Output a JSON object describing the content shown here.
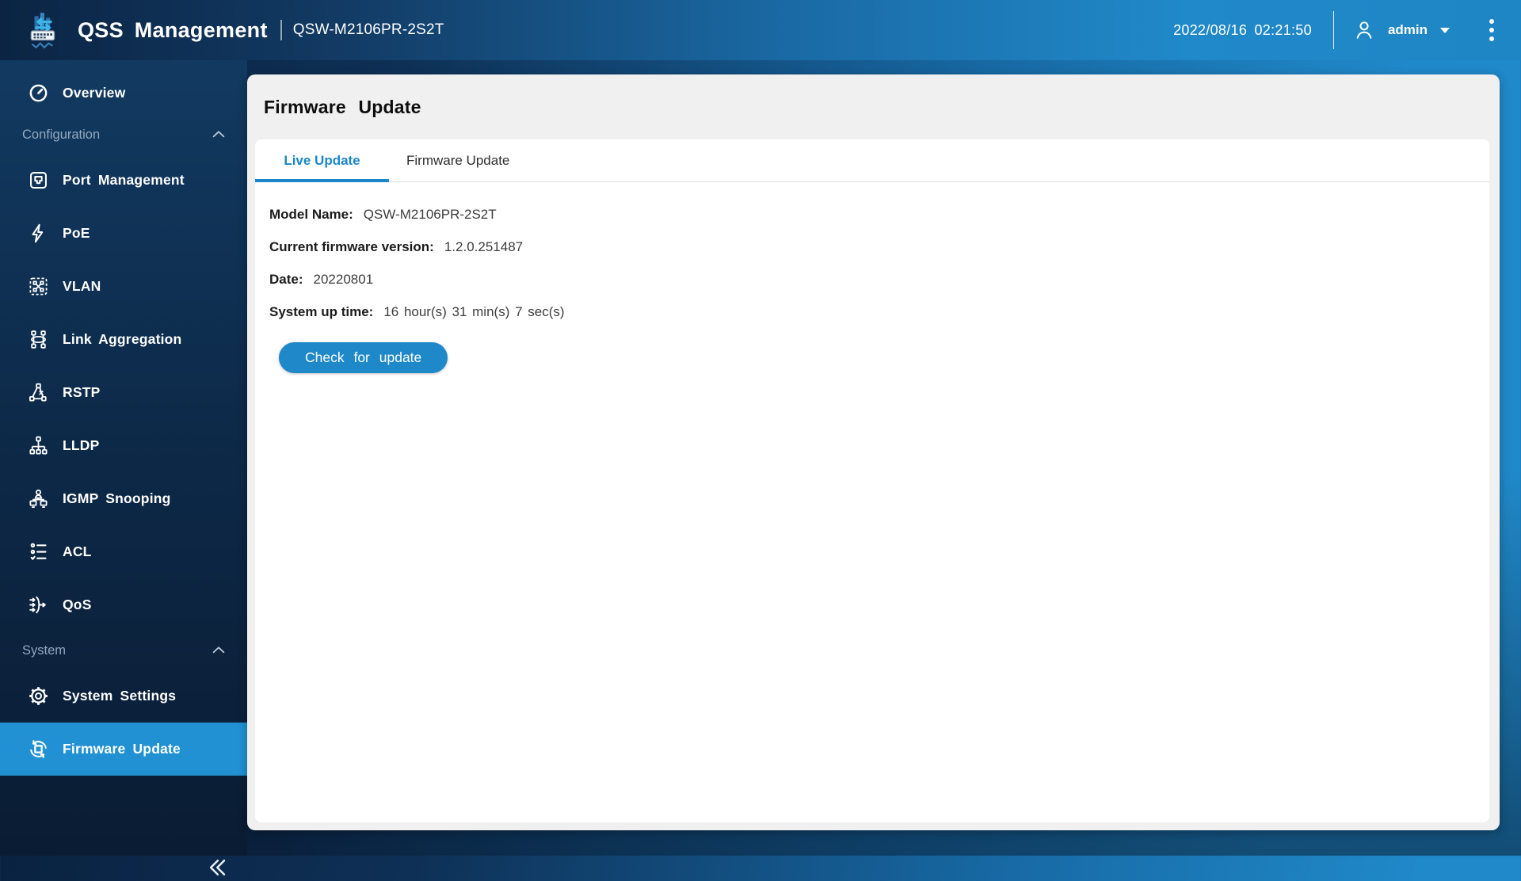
{
  "topbar": {
    "app_title": "QSS Management",
    "device_model": "QSW-M2106PR-2S2T",
    "datetime": "2022/08/16 02:21:50",
    "user": "admin"
  },
  "sidebar": {
    "items": [
      {
        "type": "item",
        "label": "Overview",
        "icon": "overview-icon"
      },
      {
        "type": "section",
        "label": "Configuration"
      },
      {
        "type": "item",
        "label": "Port Management",
        "icon": "port-management-icon"
      },
      {
        "type": "item",
        "label": "PoE",
        "icon": "poe-icon"
      },
      {
        "type": "item",
        "label": "VLAN",
        "icon": "vlan-icon"
      },
      {
        "type": "item",
        "label": "Link Aggregation",
        "icon": "link-aggregation-icon"
      },
      {
        "type": "item",
        "label": "RSTP",
        "icon": "rstp-icon"
      },
      {
        "type": "item",
        "label": "LLDP",
        "icon": "lldp-icon"
      },
      {
        "type": "item",
        "label": "IGMP Snooping",
        "icon": "igmp-snooping-icon"
      },
      {
        "type": "item",
        "label": "ACL",
        "icon": "acl-icon"
      },
      {
        "type": "item",
        "label": "QoS",
        "icon": "qos-icon"
      },
      {
        "type": "section",
        "label": "System"
      },
      {
        "type": "item",
        "label": "System Settings",
        "icon": "system-settings-icon"
      },
      {
        "type": "item",
        "label": "Firmware Update",
        "icon": "firmware-update-icon",
        "active": true
      }
    ]
  },
  "page": {
    "title": "Firmware Update",
    "tabs": [
      {
        "label": "Live Update",
        "active": true
      },
      {
        "label": "Firmware Update",
        "active": false
      }
    ],
    "fields": [
      {
        "label": "Model Name:",
        "value": "QSW-M2106PR-2S2T"
      },
      {
        "label": "Current firmware version:",
        "value": "1.2.0.251487"
      },
      {
        "label": "Date:",
        "value": "20220801"
      },
      {
        "label": "System up time:",
        "value": "16 hour(s) 31 min(s) 7 sec(s)"
      }
    ],
    "check_button": "Check for update"
  },
  "colors": {
    "accent_blue": "#1e88c9",
    "sidebar_active": "#2191d3",
    "topbar_left": "#0b2444",
    "topbar_right": "#2089c9",
    "card_bg": "#f0f0f1",
    "panel_bg": "#ffffff",
    "section_label": "#92a9c1"
  }
}
